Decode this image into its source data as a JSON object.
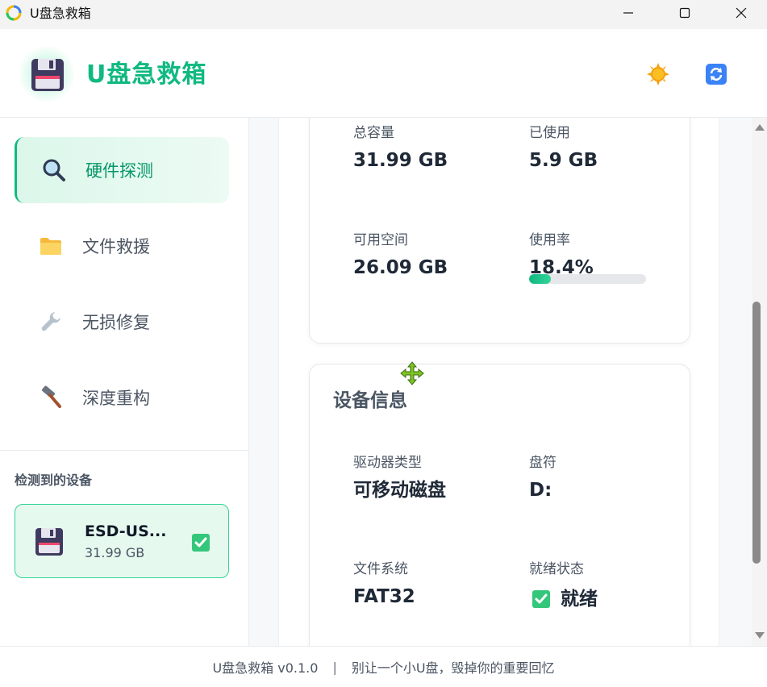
{
  "window": {
    "title": "U盘急救箱",
    "icons": {
      "app": "app-logo-icon",
      "minimize": "minimize-icon",
      "maximize": "maximize-icon",
      "close": "close-icon"
    }
  },
  "header": {
    "app_name": "U盘急救箱",
    "logo_icon": "floppy-disk-icon",
    "actions": [
      {
        "name": "theme-toggle",
        "icon": "sun-icon"
      },
      {
        "name": "refresh",
        "icon": "refresh-icon"
      }
    ]
  },
  "sidebar": {
    "nav": [
      {
        "label": "硬件探测",
        "icon": "magnifier-icon",
        "active": true
      },
      {
        "label": "文件救援",
        "icon": "folder-icon",
        "active": false
      },
      {
        "label": "无损修复",
        "icon": "wrench-icon",
        "active": false
      },
      {
        "label": "深度重构",
        "icon": "hammer-icon",
        "active": false
      }
    ],
    "devices_title": "检测到的设备",
    "devices": [
      {
        "name": "ESD-US...",
        "size": "31.99 GB",
        "selected": true,
        "icon": "floppy-disk-icon"
      }
    ]
  },
  "stats": {
    "total_label": "总容量",
    "total_value": "31.99 GB",
    "used_label": "已使用",
    "used_value": "5.9 GB",
    "free_label": "可用空间",
    "free_value": "26.09 GB",
    "usage_label": "使用率",
    "usage_value": "18.4%",
    "usage_fraction": 0.184
  },
  "device_info": {
    "title": "设备信息",
    "drive_type_label": "驱动器类型",
    "drive_type_value": "可移动磁盘",
    "letter_label": "盘符",
    "letter_value": "D:",
    "fs_label": "文件系统",
    "fs_value": "FAT32",
    "status_label": "就绪状态",
    "status_value": "就绪"
  },
  "footer": {
    "version": "U盘急救箱 v0.1.0",
    "separator": "|",
    "slogan": "别让一个小U盘，毁掉你的重要回忆"
  },
  "colors": {
    "accent": "#10b981",
    "accent_light": "#e6f9ef",
    "text_primary": "#1f2937",
    "text_secondary": "#4b5563"
  }
}
